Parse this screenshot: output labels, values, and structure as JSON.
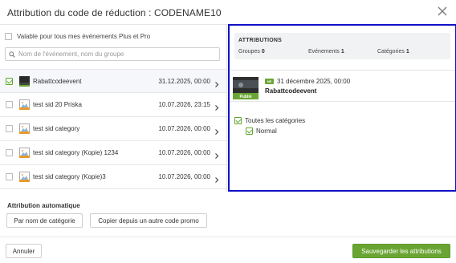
{
  "dialog": {
    "title": "Attribution du code de réduction : CODENAME10"
  },
  "filter": {
    "plus_pro_label": "Valable pour tous mes événements Plus et Pro",
    "search_placeholder": "Nom de l'événement, nom du groupe"
  },
  "events": [
    {
      "name": "Rabattcodeevent",
      "date": "31.12.2025, 00:00",
      "checked": true,
      "thumb": "dark-photo"
    },
    {
      "name": "test sid 20 Priska",
      "date": "10.07.2026, 23:15",
      "checked": false,
      "thumb": "image-placeholder"
    },
    {
      "name": "test sid category",
      "date": "10.07.2026, 00:00",
      "checked": false,
      "thumb": "image-placeholder"
    },
    {
      "name": "test sid category (Kopie) 1234",
      "date": "10.07.2026, 00:00",
      "checked": false,
      "thumb": "image-placeholder"
    },
    {
      "name": "test sid category (Kopie)3",
      "date": "10.07.2026, 00:00",
      "checked": false,
      "thumb": "image-placeholder"
    }
  ],
  "attributions": {
    "title": "ATTRIBUTIONS",
    "groups_label": "Groupes",
    "groups_count": "0",
    "events_label": "Evénements",
    "events_count": "1",
    "categories_label": "Catégories",
    "categories_count": "1"
  },
  "selected_event": {
    "badge": "HE",
    "date": "31 décembre 2025, 00:00",
    "name": "Rabattcodeevent",
    "status": "Publié"
  },
  "categories": {
    "all_label": "Toutes les catégories",
    "all_checked": true,
    "items": [
      {
        "label": "Normal",
        "checked": true
      }
    ]
  },
  "auto": {
    "title": "Attribution automatique",
    "by_category_button": "Par nom de catégorie",
    "copy_button": "Copier depuis un autre code promo"
  },
  "footer": {
    "cancel_button": "Annuler",
    "save_button": "Sauvegarder les attributions"
  },
  "colors": {
    "accent_green": "#6aa533",
    "highlight_border": "#1010c8"
  }
}
